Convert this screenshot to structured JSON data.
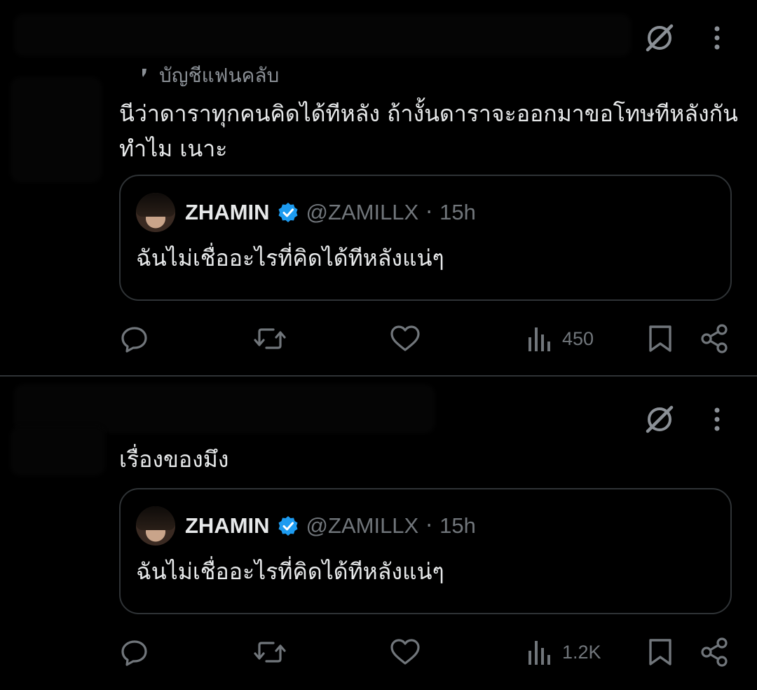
{
  "posts": [
    {
      "context_label": "บัญชีแฟนคลับ",
      "text_lines": [
        "นีว่าดาราทุกคนคิดได้ทีหลัง ถ้างั้นดาราจะออกมาขอโทษทีหลังกัน",
        "ทำไม เนาะ"
      ],
      "quote": {
        "name": "ZHAMIN",
        "handle": "@ZAMILLX",
        "dot": "·",
        "time": "15h",
        "text": "ฉันไม่เชื่ออะไรที่คิดได้ทีหลังแน่ๆ"
      },
      "views": "450"
    },
    {
      "text_lines": [
        "เรื่องของมึง"
      ],
      "quote": {
        "name": "ZHAMIN",
        "handle": "@ZAMILLX",
        "dot": "·",
        "time": "15h",
        "text": "ฉันไม่เชื่ออะไรที่คิดได้ทีหลังแน่ๆ"
      },
      "views": "1.2K"
    }
  ],
  "colors": {
    "background": "#000000",
    "text": "#e7e9ea",
    "muted": "#71767b",
    "border": "#2f3336",
    "verified": "#1d9bf0"
  },
  "icons": [
    "grok-icon",
    "more-vertical-icon",
    "reply-icon",
    "repost-icon",
    "like-icon",
    "views-icon",
    "bookmark-icon",
    "share-icon",
    "verified-badge-icon"
  ]
}
